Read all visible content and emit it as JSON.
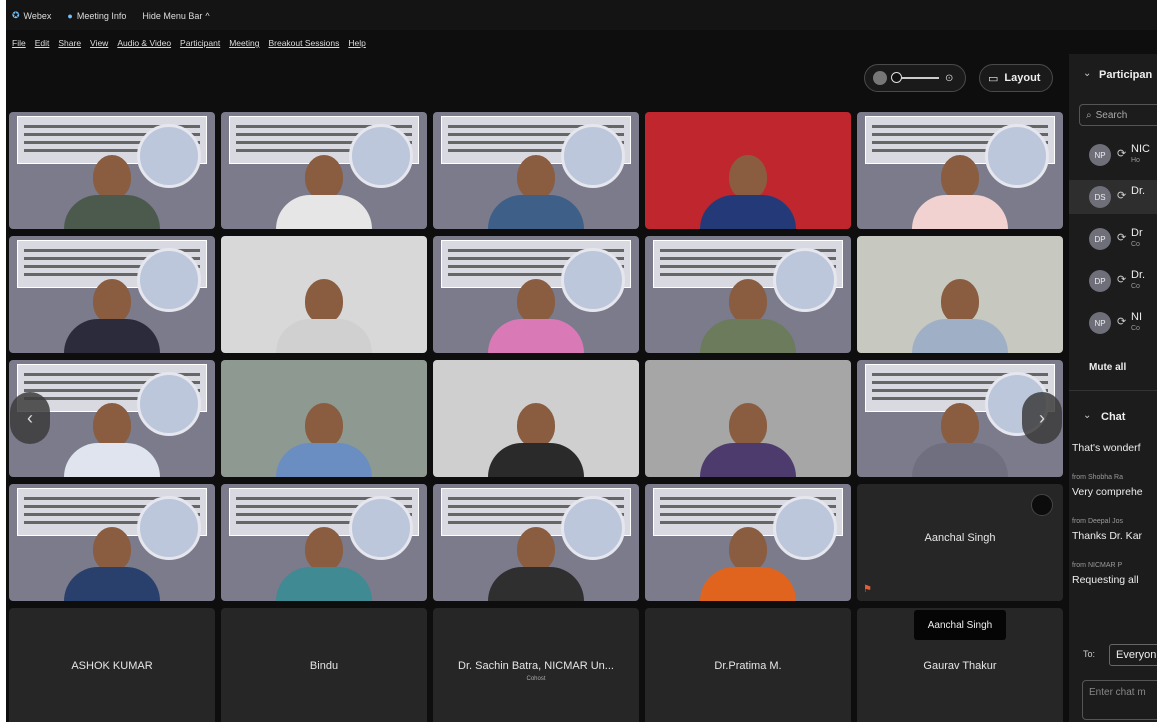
{
  "topbar": {
    "app_name": "Webex",
    "meeting_info": "Meeting Info",
    "hide_menu_bar": "Hide Menu Bar"
  },
  "menu": [
    "File",
    "Edit",
    "Share",
    "View",
    "Audio & Video",
    "Participant",
    "Meeting",
    "Breakout Sessions",
    "Help"
  ],
  "controls": {
    "layout_label": "Layout"
  },
  "video_grid": {
    "accent_colors": {
      "slide_bg": "#7b7b8c",
      "tile_dark": "#262626"
    },
    "rows": [
      [
        {
          "type": "slide",
          "shirt": "#4c5a4e"
        },
        {
          "type": "slide",
          "shirt": "#e6e6e6"
        },
        {
          "type": "slide",
          "shirt": "#3e5f88"
        },
        {
          "type": "camera",
          "bg": "#c0262e",
          "shirt": "#243a78"
        },
        {
          "type": "slide",
          "shirt": "#f2d2d0"
        }
      ],
      [
        {
          "type": "slide",
          "shirt": "#2b2b3b"
        },
        {
          "type": "camera",
          "bg": "#d8d8d8",
          "shirt": "#d0d0d0"
        },
        {
          "type": "slide",
          "shirt": "#d97ab7"
        },
        {
          "type": "slide",
          "shirt": "#6b7b5b"
        },
        {
          "type": "camera",
          "bg": "#c7c9c0",
          "shirt": "#9fb0c6"
        }
      ],
      [
        {
          "type": "slide",
          "shirt": "#dfe4ef"
        },
        {
          "type": "camera",
          "bg": "#8e9a91",
          "shirt": "#6a8dc2"
        },
        {
          "type": "camera",
          "bg": "#cfcfcf",
          "shirt": "#2a2a2a"
        },
        {
          "type": "camera",
          "bg": "#a6a6a6",
          "shirt": "#4d3b6e"
        },
        {
          "type": "slide",
          "shirt": "#6f6f7f"
        }
      ],
      [
        {
          "type": "slide",
          "shirt": "#28406b"
        },
        {
          "type": "slide",
          "shirt": "#3f8a93"
        },
        {
          "type": "slide",
          "shirt": "#2f2f2f"
        },
        {
          "type": "slide",
          "shirt": "#e0641e"
        },
        {
          "type": "name",
          "name": "Aanchal Singh"
        }
      ],
      [
        {
          "type": "name",
          "name": "ASHOK KUMAR"
        },
        {
          "type": "name",
          "name": "Bindu"
        },
        {
          "type": "name",
          "name": "Dr. Sachin Batra, NICMAR Un...",
          "sub": "Cohost"
        },
        {
          "type": "name",
          "name": "Dr.Pratima M."
        },
        {
          "type": "name",
          "name": "Gaurav Thakur"
        }
      ]
    ]
  },
  "tooltip": "Aanchal Singh",
  "participants_panel": {
    "title": "Participan",
    "search_placeholder": "Search",
    "list": [
      {
        "initials": "NP",
        "name": "NIC",
        "sub": "Ho"
      },
      {
        "initials": "DS",
        "name": "Dr.",
        "sub": ""
      },
      {
        "initials": "DP",
        "name": "Dr",
        "sub": "Co"
      },
      {
        "initials": "DP",
        "name": "Dr.",
        "sub": "Co"
      },
      {
        "initials": "NP",
        "name": "NI",
        "sub": "Co"
      }
    ],
    "mute_all": "Mute all"
  },
  "chat_panel": {
    "title": "Chat",
    "messages": [
      {
        "from": "",
        "text": "That's wonderf"
      },
      {
        "from": "from Shobha Ra",
        "text": "Very comprehe"
      },
      {
        "from": "from Deepal Jos",
        "text": "Thanks Dr. Kar"
      },
      {
        "from": "from NICMAR P",
        "text": "Requesting all"
      }
    ],
    "to_label": "To:",
    "to_value": "Everyon",
    "input_placeholder": "Enter chat m"
  }
}
